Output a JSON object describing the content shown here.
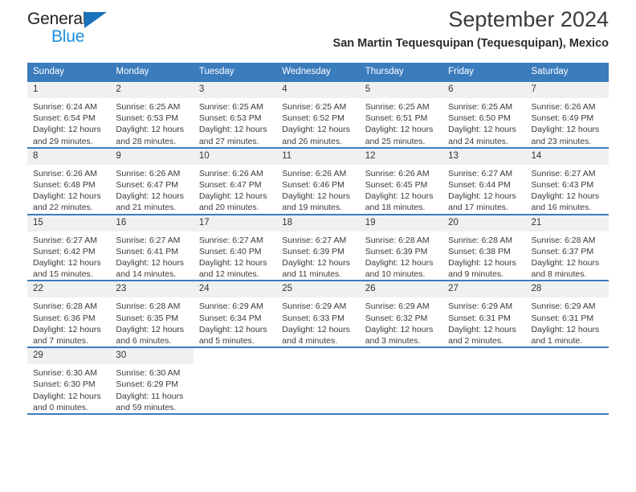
{
  "brand": {
    "name_part1": "General",
    "name_part2": "Blue",
    "triangle_color": "#1a72bb",
    "blue_color": "#1a8fdc"
  },
  "header": {
    "month_title": "September 2024",
    "location": "San Martin Tequesquipan (Tequesquipan), Mexico"
  },
  "theme": {
    "header_bg": "#3b7cbd",
    "daynum_bg": "#f0f0f0",
    "text_color": "#3a3a3a"
  },
  "weekdays": [
    "Sunday",
    "Monday",
    "Tuesday",
    "Wednesday",
    "Thursday",
    "Friday",
    "Saturday"
  ],
  "weeks": [
    [
      {
        "day": "1",
        "sunrise": "Sunrise: 6:24 AM",
        "sunset": "Sunset: 6:54 PM",
        "daylight": "Daylight: 12 hours and 29 minutes."
      },
      {
        "day": "2",
        "sunrise": "Sunrise: 6:25 AM",
        "sunset": "Sunset: 6:53 PM",
        "daylight": "Daylight: 12 hours and 28 minutes."
      },
      {
        "day": "3",
        "sunrise": "Sunrise: 6:25 AM",
        "sunset": "Sunset: 6:53 PM",
        "daylight": "Daylight: 12 hours and 27 minutes."
      },
      {
        "day": "4",
        "sunrise": "Sunrise: 6:25 AM",
        "sunset": "Sunset: 6:52 PM",
        "daylight": "Daylight: 12 hours and 26 minutes."
      },
      {
        "day": "5",
        "sunrise": "Sunrise: 6:25 AM",
        "sunset": "Sunset: 6:51 PM",
        "daylight": "Daylight: 12 hours and 25 minutes."
      },
      {
        "day": "6",
        "sunrise": "Sunrise: 6:25 AM",
        "sunset": "Sunset: 6:50 PM",
        "daylight": "Daylight: 12 hours and 24 minutes."
      },
      {
        "day": "7",
        "sunrise": "Sunrise: 6:26 AM",
        "sunset": "Sunset: 6:49 PM",
        "daylight": "Daylight: 12 hours and 23 minutes."
      }
    ],
    [
      {
        "day": "8",
        "sunrise": "Sunrise: 6:26 AM",
        "sunset": "Sunset: 6:48 PM",
        "daylight": "Daylight: 12 hours and 22 minutes."
      },
      {
        "day": "9",
        "sunrise": "Sunrise: 6:26 AM",
        "sunset": "Sunset: 6:47 PM",
        "daylight": "Daylight: 12 hours and 21 minutes."
      },
      {
        "day": "10",
        "sunrise": "Sunrise: 6:26 AM",
        "sunset": "Sunset: 6:47 PM",
        "daylight": "Daylight: 12 hours and 20 minutes."
      },
      {
        "day": "11",
        "sunrise": "Sunrise: 6:26 AM",
        "sunset": "Sunset: 6:46 PM",
        "daylight": "Daylight: 12 hours and 19 minutes."
      },
      {
        "day": "12",
        "sunrise": "Sunrise: 6:26 AM",
        "sunset": "Sunset: 6:45 PM",
        "daylight": "Daylight: 12 hours and 18 minutes."
      },
      {
        "day": "13",
        "sunrise": "Sunrise: 6:27 AM",
        "sunset": "Sunset: 6:44 PM",
        "daylight": "Daylight: 12 hours and 17 minutes."
      },
      {
        "day": "14",
        "sunrise": "Sunrise: 6:27 AM",
        "sunset": "Sunset: 6:43 PM",
        "daylight": "Daylight: 12 hours and 16 minutes."
      }
    ],
    [
      {
        "day": "15",
        "sunrise": "Sunrise: 6:27 AM",
        "sunset": "Sunset: 6:42 PM",
        "daylight": "Daylight: 12 hours and 15 minutes."
      },
      {
        "day": "16",
        "sunrise": "Sunrise: 6:27 AM",
        "sunset": "Sunset: 6:41 PM",
        "daylight": "Daylight: 12 hours and 14 minutes."
      },
      {
        "day": "17",
        "sunrise": "Sunrise: 6:27 AM",
        "sunset": "Sunset: 6:40 PM",
        "daylight": "Daylight: 12 hours and 12 minutes."
      },
      {
        "day": "18",
        "sunrise": "Sunrise: 6:27 AM",
        "sunset": "Sunset: 6:39 PM",
        "daylight": "Daylight: 12 hours and 11 minutes."
      },
      {
        "day": "19",
        "sunrise": "Sunrise: 6:28 AM",
        "sunset": "Sunset: 6:39 PM",
        "daylight": "Daylight: 12 hours and 10 minutes."
      },
      {
        "day": "20",
        "sunrise": "Sunrise: 6:28 AM",
        "sunset": "Sunset: 6:38 PM",
        "daylight": "Daylight: 12 hours and 9 minutes."
      },
      {
        "day": "21",
        "sunrise": "Sunrise: 6:28 AM",
        "sunset": "Sunset: 6:37 PM",
        "daylight": "Daylight: 12 hours and 8 minutes."
      }
    ],
    [
      {
        "day": "22",
        "sunrise": "Sunrise: 6:28 AM",
        "sunset": "Sunset: 6:36 PM",
        "daylight": "Daylight: 12 hours and 7 minutes."
      },
      {
        "day": "23",
        "sunrise": "Sunrise: 6:28 AM",
        "sunset": "Sunset: 6:35 PM",
        "daylight": "Daylight: 12 hours and 6 minutes."
      },
      {
        "day": "24",
        "sunrise": "Sunrise: 6:29 AM",
        "sunset": "Sunset: 6:34 PM",
        "daylight": "Daylight: 12 hours and 5 minutes."
      },
      {
        "day": "25",
        "sunrise": "Sunrise: 6:29 AM",
        "sunset": "Sunset: 6:33 PM",
        "daylight": "Daylight: 12 hours and 4 minutes."
      },
      {
        "day": "26",
        "sunrise": "Sunrise: 6:29 AM",
        "sunset": "Sunset: 6:32 PM",
        "daylight": "Daylight: 12 hours and 3 minutes."
      },
      {
        "day": "27",
        "sunrise": "Sunrise: 6:29 AM",
        "sunset": "Sunset: 6:31 PM",
        "daylight": "Daylight: 12 hours and 2 minutes."
      },
      {
        "day": "28",
        "sunrise": "Sunrise: 6:29 AM",
        "sunset": "Sunset: 6:31 PM",
        "daylight": "Daylight: 12 hours and 1 minute."
      }
    ],
    [
      {
        "day": "29",
        "sunrise": "Sunrise: 6:30 AM",
        "sunset": "Sunset: 6:30 PM",
        "daylight": "Daylight: 12 hours and 0 minutes."
      },
      {
        "day": "30",
        "sunrise": "Sunrise: 6:30 AM",
        "sunset": "Sunset: 6:29 PM",
        "daylight": "Daylight: 11 hours and 59 minutes."
      },
      {
        "day": "",
        "sunrise": "",
        "sunset": "",
        "daylight": ""
      },
      {
        "day": "",
        "sunrise": "",
        "sunset": "",
        "daylight": ""
      },
      {
        "day": "",
        "sunrise": "",
        "sunset": "",
        "daylight": ""
      },
      {
        "day": "",
        "sunrise": "",
        "sunset": "",
        "daylight": ""
      },
      {
        "day": "",
        "sunrise": "",
        "sunset": "",
        "daylight": ""
      }
    ]
  ]
}
